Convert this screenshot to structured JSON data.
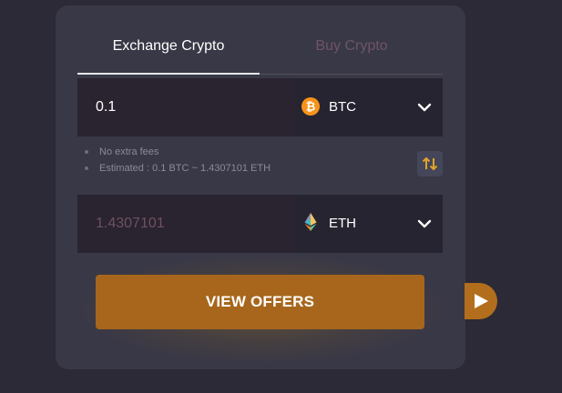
{
  "tabs": [
    {
      "label": "Exchange Crypto",
      "active": true
    },
    {
      "label": "Buy Crypto",
      "active": false
    }
  ],
  "from": {
    "amount": "0.1",
    "currency": "BTC",
    "icon": "bitcoin-icon",
    "icon_color": "#f7931a"
  },
  "notes": [
    "No extra fees",
    "Estimated : 0.1 BTC ~ 1.4307101 ETH"
  ],
  "to": {
    "amount": "1.4307101",
    "currency": "ETH",
    "icon": "ethereum-icon"
  },
  "cta": {
    "label": "VIEW OFFERS"
  },
  "colors": {
    "accent": "#a7661b",
    "card": "#393846",
    "background": "#2c2a36"
  }
}
